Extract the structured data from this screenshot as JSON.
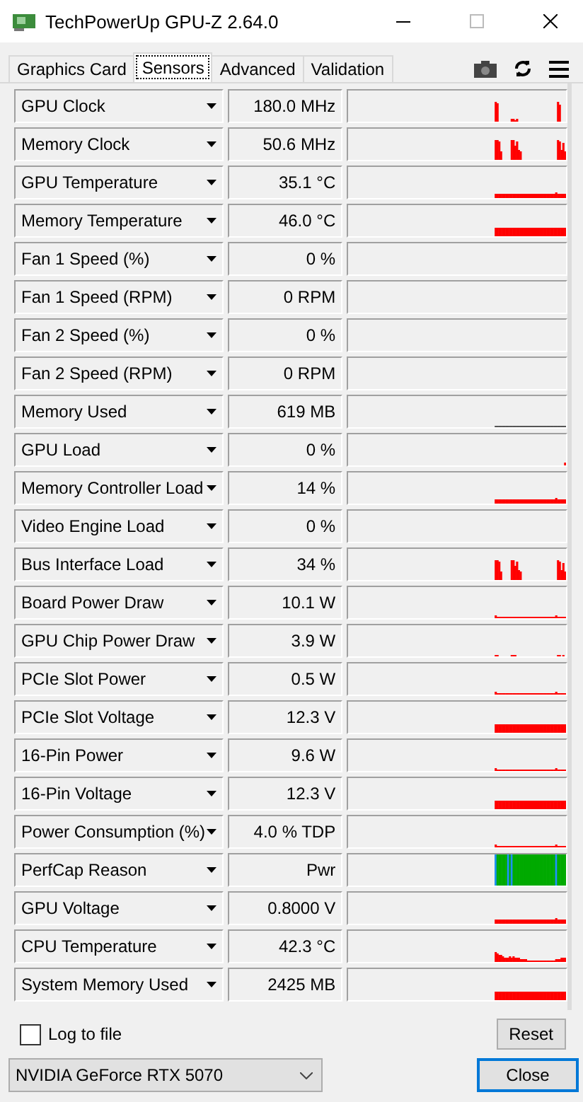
{
  "window": {
    "title": "TechPowerUp GPU-Z 2.64.0"
  },
  "tabs": [
    {
      "label": "Graphics Card",
      "selected": false
    },
    {
      "label": "Sensors",
      "selected": true
    },
    {
      "label": "Advanced",
      "selected": false
    },
    {
      "label": "Validation",
      "selected": false
    }
  ],
  "sensors": [
    {
      "name": "GPU Clock",
      "value": "180.0 MHz",
      "kind": "spikes"
    },
    {
      "name": "Memory Clock",
      "value": "50.6 MHz",
      "kind": "tall"
    },
    {
      "name": "GPU Temperature",
      "value": "35.1 °C",
      "kind": "low"
    },
    {
      "name": "Memory Temperature",
      "value": "46.0 °C",
      "kind": "block"
    },
    {
      "name": "Fan 1 Speed (%)",
      "value": "0 %",
      "kind": "none"
    },
    {
      "name": "Fan 1 Speed (RPM)",
      "value": "0 RPM",
      "kind": "none"
    },
    {
      "name": "Fan 2 Speed (%)",
      "value": "0 %",
      "kind": "none"
    },
    {
      "name": "Fan 2 Speed (RPM)",
      "value": "0 RPM",
      "kind": "none"
    },
    {
      "name": "Memory Used",
      "value": "619 MB",
      "kind": "line"
    },
    {
      "name": "GPU Load",
      "value": "0 %",
      "kind": "tick"
    },
    {
      "name": "Memory Controller Load",
      "value": "14 %",
      "kind": "low"
    },
    {
      "name": "Video Engine Load",
      "value": "0 %",
      "kind": "none"
    },
    {
      "name": "Bus Interface Load",
      "value": "34 %",
      "kind": "tall"
    },
    {
      "name": "Board Power Draw",
      "value": "10.1 W",
      "kind": "thin"
    },
    {
      "name": "GPU Chip Power Draw",
      "value": "3.9 W",
      "kind": "dashes"
    },
    {
      "name": "PCIe Slot Power",
      "value": "0.5 W",
      "kind": "thin"
    },
    {
      "name": "PCIe Slot Voltage",
      "value": "12.3 V",
      "kind": "block"
    },
    {
      "name": "16-Pin Power",
      "value": "9.6 W",
      "kind": "thin"
    },
    {
      "name": "16-Pin Voltage",
      "value": "12.3 V",
      "kind": "block"
    },
    {
      "name": "Power Consumption (%)",
      "value": "4.0 % TDP",
      "kind": "thin"
    },
    {
      "name": "PerfCap Reason",
      "value": "Pwr",
      "kind": "bands"
    },
    {
      "name": "GPU Voltage",
      "value": "0.8000 V",
      "kind": "low"
    },
    {
      "name": "CPU Temperature",
      "value": "42.3 °C",
      "kind": "decay"
    },
    {
      "name": "System Memory Used",
      "value": "2425 MB",
      "kind": "block"
    }
  ],
  "log_to_file": {
    "label": "Log to file",
    "checked": false
  },
  "reset_button": "Reset",
  "device": "NVIDIA GeForce RTX 5070",
  "close_button": "Close"
}
